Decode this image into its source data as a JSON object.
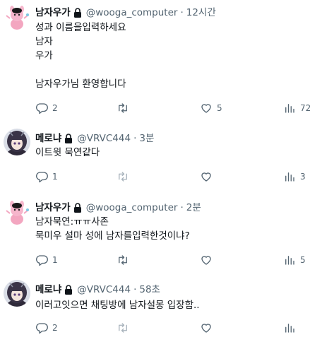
{
  "tweets": [
    {
      "name": "남자우가",
      "handle": "@wooga_computer",
      "time": "12시간",
      "avatar": "pink-character",
      "lines": [
        "성과 이름을입력하세요",
        "남자",
        "우가",
        "",
        "남자우가님 환영합니다"
      ],
      "replies": "2",
      "retweets": "",
      "likes": "5",
      "views": "72"
    },
    {
      "name": "메로냐",
      "handle": "@VRVC444",
      "time": "3분",
      "avatar": "dark-hair-character",
      "lines": [
        "이트윗 묵연같다"
      ],
      "replies": "1",
      "retweets": "",
      "likes": "",
      "views": "3"
    },
    {
      "name": "남자우가",
      "handle": "@wooga_computer",
      "time": "2분",
      "avatar": "pink-character",
      "lines": [
        "남자묵연:ㅠㅠ사존",
        "묵미우 설마 성에 남자를입력한것이냐?"
      ],
      "replies": "1",
      "retweets": "",
      "likes": "",
      "views": "5"
    },
    {
      "name": "메로냐",
      "handle": "@VRVC444",
      "time": "58초",
      "avatar": "dark-hair-character",
      "lines": [
        "이러고잇으면 채팅방에 남자설몽 입장함.."
      ],
      "replies": "2",
      "retweets": "",
      "likes": "",
      "views": ""
    }
  ],
  "dot": "·",
  "icons": {
    "lock": "lock-icon",
    "reply": "reply-icon",
    "retweet": "retweet-icon",
    "like": "heart-icon",
    "views": "analytics-icon"
  },
  "colors": {
    "text": "#0f1419",
    "secondary": "#536471",
    "background": "#ffffff"
  }
}
